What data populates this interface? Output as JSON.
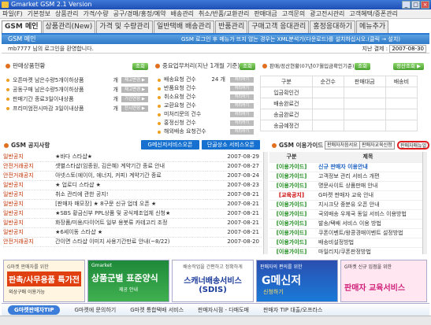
{
  "window": {
    "title": "Gmarket GSM 2.1 Version"
  },
  "menu": [
    "파일(F)",
    "기본정보",
    "상품관리",
    "가격/수량",
    "공구/경매/홍정/예약",
    "배송관리",
    "취소/반품/교환관리",
    "판매대금",
    "고객문의",
    "광고전시관리",
    "고객혜택/증폰관리"
  ],
  "tabs": [
    "GSM 메인",
    "상품관리(New)",
    "가격 및 수량관리",
    "일반택배 배송관리",
    "반품관리",
    "구매고객 응대관리",
    "홍정응대하기",
    "메뉴추가"
  ],
  "header": {
    "title": "GSM 메인",
    "notice": "GSM 로그인 후 메뉴가 뜨지 않는 경우는 XML분석기(다운로드)를 설치하십시오.(클릭 → 설치)"
  },
  "welcome": {
    "text": "mb7777 님의 로그인을 환영합니다.",
    "date_label": "지난 결제 :",
    "date": "2007-08-30"
  },
  "sales": {
    "title": "판매상품현황",
    "button": "조회",
    "items": [
      {
        "label": "오픈마켓 남은수량5개이하상품",
        "unit": "개",
        "button": "재고변경 ▶"
      },
      {
        "label": "공동구매 남은수량5개이하상품",
        "unit": "개",
        "button": "재고변경 ▶"
      },
      {
        "label": "판매기간 종료3일이내상품",
        "unit": "개",
        "button": "기간연장 ▶"
      },
      {
        "label": "프리미엄전시마감 3일이내상품",
        "unit": "개",
        "button": "전시연장 ▶"
      }
    ]
  },
  "schedule": {
    "title": "중요업무처리(지난 1개월 기준)",
    "button": "조회",
    "items": [
      {
        "label": "배송요청 건수",
        "count": "24 개",
        "button": "처리하기"
      },
      {
        "label": "반품요청 건수",
        "count": "",
        "button": "처리하기"
      },
      {
        "label": "취소요청 건수",
        "count": "",
        "button": "처리하기"
      },
      {
        "label": "교환요청 건수",
        "count": "",
        "button": "처리하기"
      },
      {
        "label": "미처리문의 건수",
        "count": "",
        "button": "처리하기"
      },
      {
        "label": "홍정신청 건수",
        "count": "",
        "button": "처리하기"
      },
      {
        "label": "해외배송 요청건수",
        "count": "",
        "button": "처리하기"
      }
    ]
  },
  "settlement": {
    "title": "판매/정산현황(07년07월입금확인기준)",
    "button1": "조회",
    "button2": "정산조회 ▶",
    "columns": [
      "구분",
      "순건수",
      "판매대금",
      "배송비"
    ],
    "rows": [
      "입금확인건",
      "배송완료건",
      "송금완료건",
      "송금예정건"
    ]
  },
  "notice": {
    "title": "GSM 공지사항",
    "btn1": "G메신저서비스오픈",
    "btn2": "단골상소 서비스오픈",
    "rows": [
      {
        "k": "일반공지",
        "t": "★바다 스타샵★",
        "d": "2007-08-29"
      },
      {
        "k": "안전거래공지",
        "t": "셋별스타샵(임종원, 김은혜) 계약기간 종료 안내",
        "d": "2007-08-27"
      },
      {
        "k": "안전거래공지",
        "t": "아넷스토(에이이, 에너지, 커피) 계약기간 종료",
        "d": "2007-08-24"
      },
      {
        "k": "일반공지",
        "t": "★ 업로디 스타샵 ★",
        "d": "2007-08-23"
      },
      {
        "k": "일반공지",
        "t": "취소 관리에 관한 공지!",
        "d": "2007-08-21"
      },
      {
        "k": "일반공지",
        "t": "[판매자 매모장] ★ 8구문 신규 업데 오픈 ★",
        "d": "2007-08-21"
      },
      {
        "k": "일반공지",
        "t": "★SBS 황금신부 PPL상품 및 공식제조업체 신청★",
        "d": "2007-08-21"
      },
      {
        "k": "일반공지",
        "t": "화장품/미용/다이어트 일부 용봇류 카테고리 조정",
        "d": "2007-08-21"
      },
      {
        "k": "일반공지",
        "t": "★6세이동 스타샵 ★",
        "d": "2007-08-21"
      },
      {
        "k": "안전거래공지",
        "t": "간이면 스타샵 이미지 사용기간만료 안내(~8/22)",
        "d": "2007-08-20"
      }
    ]
  },
  "guide": {
    "title": "GSM 이용가이드",
    "btns": [
      "판매자처음서요",
      "판매자교육신청",
      "판매자매뉴얼"
    ],
    "columns": [
      "구분",
      "제목"
    ],
    "rows": [
      {
        "k": "[이용가이드]",
        "t": "신규 판매자 이용안내",
        "red": false
      },
      {
        "k": "[이용가이드]",
        "t": "고객정보 관리 서비스 개편",
        "red": false
      },
      {
        "k": "[이용가이드]",
        "t": "명문사이트 상품판매 안내",
        "red": false
      },
      {
        "k": "[교육공지]",
        "t": "G마켓 판매자 교육 안내",
        "red": true
      },
      {
        "k": "[이용가이드]",
        "t": "지시크닷 중분유 오픈 안내",
        "red": false
      },
      {
        "k": "[이용가이드]",
        "t": "국외배송 우체국 동일 서비스 이용방법",
        "red": false
      },
      {
        "k": "[이용가이드]",
        "t": "발송/택배 서비스 이용 방법",
        "red": false
      },
      {
        "k": "[이용가이드]",
        "t": "쿠폰이벤트/왕콩경매이벤트 설정방법",
        "red": false
      },
      {
        "k": "[이용가이드]",
        "t": "배송비설정방법",
        "red": false
      },
      {
        "k": "[이용가이드]",
        "t": "마일리지/쿠폰판정방법",
        "red": false
      }
    ]
  },
  "banners": [
    {
      "small": "G마켓 판매자를 위한",
      "big": "판촉/사무용품 특가전",
      "sub": "외상구매 이용가능"
    },
    {
      "small": "Gmarket",
      "big": "상품군별 표준양식",
      "sub": "제공 안내"
    },
    {
      "small": "배송작업을 간편하고 정확하게",
      "big": "스캐너배송서비스 (SDIS)",
      "sub": ""
    },
    {
      "small": "판매자의 편의를 위한",
      "big": "G메신저",
      "sub": "신청하기"
    },
    {
      "small": "G마켓 신규 입점을 위한",
      "big": "판매자 교육서비스",
      "sub": ""
    }
  ],
  "footer": {
    "title": "G마켓판매자TIP",
    "items": [
      "G마켓에 문의하기",
      "G마켓 통합택배 서비스",
      "판매자시점 - 다매도매",
      "판매자 TIP 대출/오프라스"
    ]
  }
}
